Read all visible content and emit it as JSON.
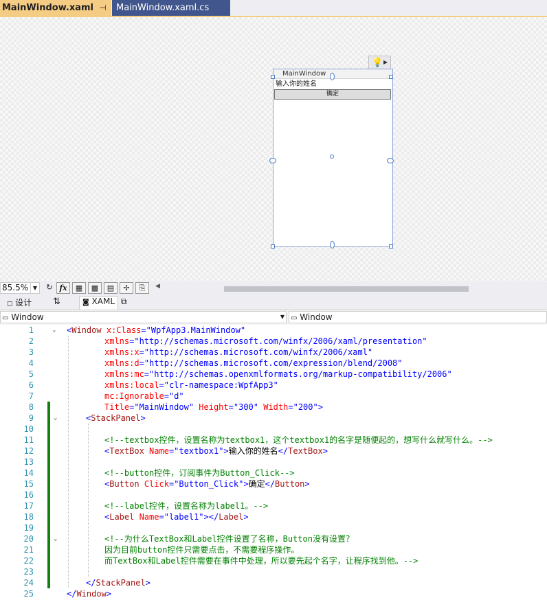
{
  "tabs": [
    {
      "label": "MainWindow.xaml",
      "active": true
    },
    {
      "label": "MainWindow.xaml.cs",
      "active": false
    }
  ],
  "designer": {
    "window_title": "MainWindow",
    "textbox_text": "输入你的姓名",
    "button_text": "确定"
  },
  "zoom": {
    "value": "85.5%"
  },
  "split": {
    "design_label": "设计",
    "xaml_label": "XAML"
  },
  "nav": {
    "left": "Window",
    "right": "Window"
  },
  "code": {
    "line_numbers": [
      "1",
      "2",
      "3",
      "4",
      "5",
      "6",
      "7",
      "8",
      "9",
      "10",
      "11",
      "12",
      "13",
      "14",
      "15",
      "16",
      "17",
      "18",
      "19",
      "20",
      "21",
      "22",
      "23",
      "24",
      "25"
    ],
    "l1": {
      "open": "<",
      "tag": "Window",
      "attr": " x:Class",
      "eq": "=",
      "val": "\"WpfApp3.MainWindow\""
    },
    "l2": {
      "attr": "xmlns",
      "eq": "=",
      "val": "\"http://schemas.microsoft.com/winfx/2006/xaml/presentation\""
    },
    "l3": {
      "attr": "xmlns:x",
      "eq": "=",
      "val": "\"http://schemas.microsoft.com/winfx/2006/xaml\""
    },
    "l4": {
      "attr": "xmlns:d",
      "eq": "=",
      "val": "\"http://schemas.microsoft.com/expression/blend/2008\""
    },
    "l5": {
      "attr": "xmlns:mc",
      "eq": "=",
      "val": "\"http://schemas.openxmlformats.org/markup-compatibility/2006\""
    },
    "l6": {
      "attr": "xmlns:local",
      "eq": "=",
      "val": "\"clr-namespace:WpfApp3\""
    },
    "l7": {
      "attr": "mc:Ignorable",
      "eq": "=",
      "val": "\"d\""
    },
    "l8": {
      "a1": "Title",
      "v1": "\"MainWindow\"",
      "a2": " Height",
      "v2": "\"300\"",
      "a3": " Width",
      "v3": "\"200\"",
      "close": ">"
    },
    "l9": {
      "open": "<",
      "tag": "StackPanel",
      "close": ">"
    },
    "l11": "<!--textbox控件，设置名称为textbox1，这个textbox1的名字是随便起的，想写什么就写什么。-->",
    "l12": {
      "open": "<",
      "tag": "TextBox",
      "attr": " Name",
      "eq": "=",
      "val": "\"textbox1\"",
      "close": ">",
      "content": "输入你的姓名",
      "end_open": "</",
      "end_tag": "TextBox",
      "end_close": ">"
    },
    "l14": "<!--button控件，订阅事件为Button_Click-->",
    "l15": {
      "open": "<",
      "tag": "Button",
      "attr": " Click",
      "eq": "=",
      "val": "\"Button_Click\"",
      "close": ">",
      "content": "确定",
      "end_open": "</",
      "end_tag": "Button",
      "end_close": ">"
    },
    "l17": "<!--label控件，设置名称为label1。-->",
    "l18": {
      "open": "<",
      "tag": "Label",
      "attr": " Name",
      "eq": "=",
      "val": "\"label1\"",
      "close": "></",
      "end_tag": "Label",
      "end_close": ">"
    },
    "l20": "<!--为什么TextBox和Label控件设置了名称，Button没有设置？",
    "l21": "因为目前button控件只需要点击，不需要程序操作。",
    "l22": "而TextBox和Label控件需要在事件中处理，所以要先起个名字，让程序找到他。-->",
    "l24": {
      "open": "</",
      "tag": "StackPanel",
      "close": ">"
    },
    "l25": {
      "open": "</",
      "tag": "Window",
      "close": ">"
    }
  }
}
